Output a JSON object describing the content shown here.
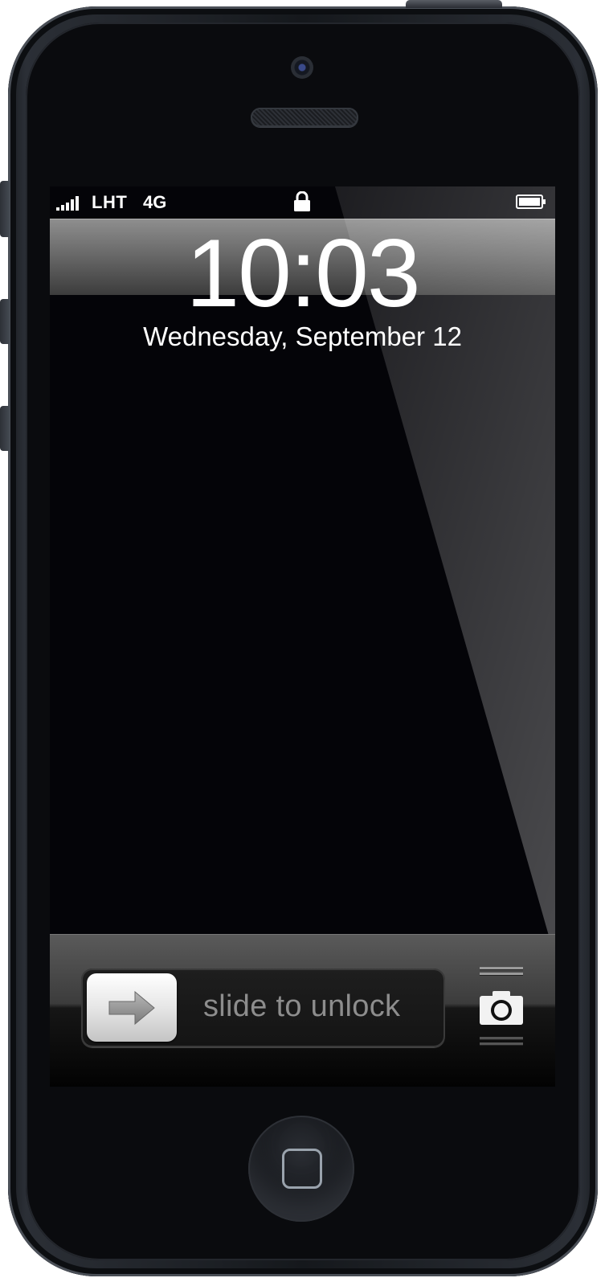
{
  "status_bar": {
    "carrier": "LHT",
    "network": "4G",
    "signal_bars": 5,
    "lock_icon": "lock-icon",
    "battery_icon": "battery-icon"
  },
  "lock_screen": {
    "time": "10:03",
    "date": "Wednesday, September 12"
  },
  "slider": {
    "label": "slide to unlock",
    "knob_icon": "arrow-right-icon",
    "camera_icon": "camera-icon"
  },
  "hardware": {
    "home_button_icon": "home-square-icon"
  },
  "colors": {
    "screen_background": "#040408",
    "text": "#ffffff",
    "slide_text": "#8d8d8d"
  }
}
